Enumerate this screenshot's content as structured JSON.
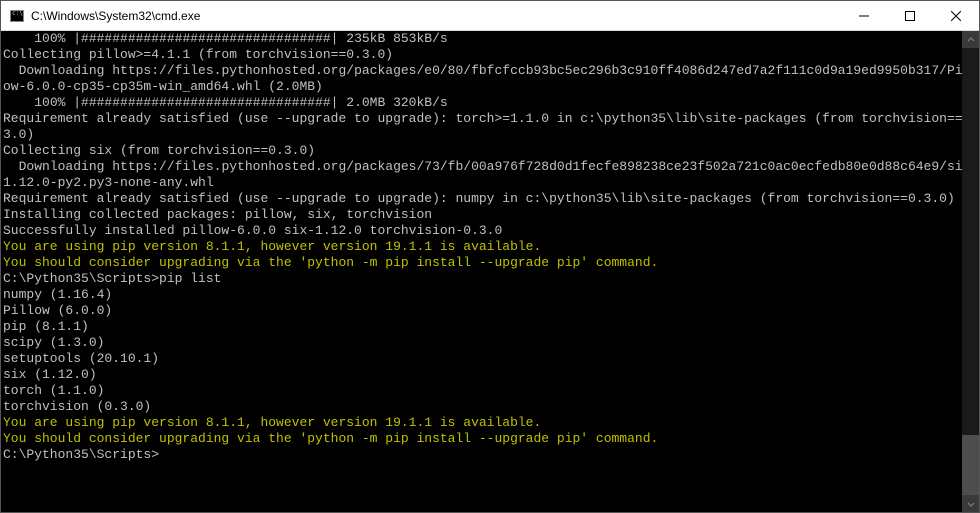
{
  "window": {
    "title": "C:\\Windows\\System32\\cmd.exe"
  },
  "lines": [
    {
      "cls": "",
      "text": "    100% |################################| 235kB 853kB/s"
    },
    {
      "cls": "",
      "text": "Collecting pillow>=4.1.1 (from torchvision==0.3.0)"
    },
    {
      "cls": "",
      "text": "  Downloading https://files.pythonhosted.org/packages/e0/80/fbfcfccb93bc5ec296b3c910ff4086d247ed7a2f111c0d9a19ed9950b317/Pillow-6.0.0-cp35-cp35m-win_amd64.whl (2.0MB)"
    },
    {
      "cls": "",
      "text": "    100% |################################| 2.0MB 320kB/s"
    },
    {
      "cls": "",
      "text": "Requirement already satisfied (use --upgrade to upgrade): torch>=1.1.0 in c:\\python35\\lib\\site-packages (from torchvision==0.3.0)"
    },
    {
      "cls": "",
      "text": "Collecting six (from torchvision==0.3.0)"
    },
    {
      "cls": "",
      "text": "  Downloading https://files.pythonhosted.org/packages/73/fb/00a976f728d0d1fecfe898238ce23f502a721c0ac0ecfedb80e0d88c64e9/six-1.12.0-py2.py3-none-any.whl"
    },
    {
      "cls": "",
      "text": "Requirement already satisfied (use --upgrade to upgrade): numpy in c:\\python35\\lib\\site-packages (from torchvision==0.3.0)"
    },
    {
      "cls": "",
      "text": "Installing collected packages: pillow, six, torchvision"
    },
    {
      "cls": "",
      "text": "Successfully installed pillow-6.0.0 six-1.12.0 torchvision-0.3.0"
    },
    {
      "cls": "yellow",
      "text": "You are using pip version 8.1.1, however version 19.1.1 is available."
    },
    {
      "cls": "yellow",
      "text": "You should consider upgrading via the 'python -m pip install --upgrade pip' command."
    },
    {
      "cls": "",
      "text": ""
    },
    {
      "cls": "",
      "text": "C:\\Python35\\Scripts>pip list"
    },
    {
      "cls": "",
      "text": "numpy (1.16.4)"
    },
    {
      "cls": "",
      "text": "Pillow (6.0.0)"
    },
    {
      "cls": "",
      "text": "pip (8.1.1)"
    },
    {
      "cls": "",
      "text": "scipy (1.3.0)"
    },
    {
      "cls": "",
      "text": "setuptools (20.10.1)"
    },
    {
      "cls": "",
      "text": "six (1.12.0)"
    },
    {
      "cls": "",
      "text": "torch (1.1.0)"
    },
    {
      "cls": "",
      "text": "torchvision (0.3.0)"
    },
    {
      "cls": "yellow",
      "text": "You are using pip version 8.1.1, however version 19.1.1 is available."
    },
    {
      "cls": "yellow",
      "text": "You should consider upgrading via the 'python -m pip install --upgrade pip' command."
    },
    {
      "cls": "",
      "text": ""
    },
    {
      "cls": "",
      "text": "C:\\Python35\\Scripts>"
    }
  ]
}
